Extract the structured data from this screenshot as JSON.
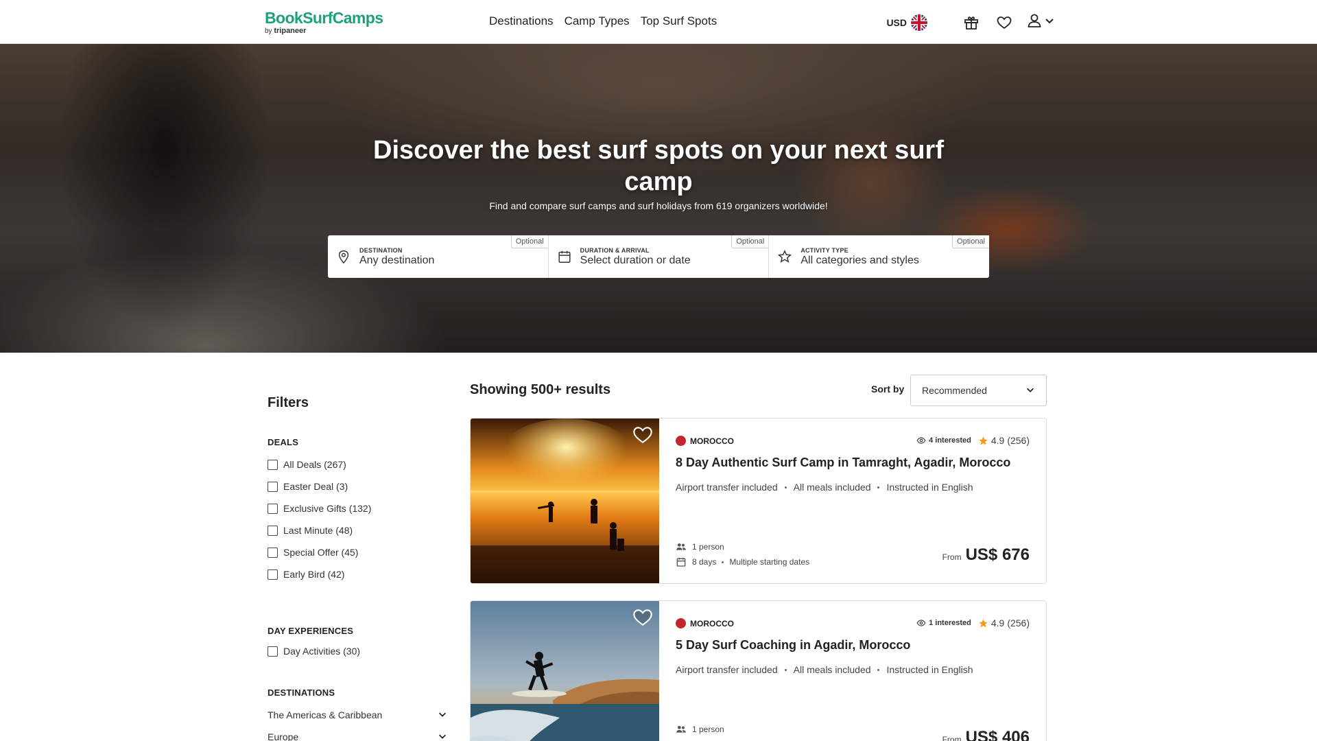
{
  "header": {
    "logo_main": "BookSurfCamps",
    "logo_by": "by",
    "logo_sub": "tripaneer",
    "nav": [
      "Destinations",
      "Camp Types",
      "Top Surf Spots"
    ],
    "currency": "USD"
  },
  "hero": {
    "title": "Discover the best surf spots on your next surf camp",
    "subtitle": "Find and compare surf camps and surf holidays from 619 organizers worldwide!",
    "search": [
      {
        "label": "DESTINATION",
        "value": "Any destination",
        "optional": "Optional"
      },
      {
        "label": "DURATION & ARRIVAL",
        "value": "Select duration or date",
        "optional": "Optional"
      },
      {
        "label": "ACTIVITY TYPE",
        "value": "All categories and styles",
        "optional": "Optional"
      }
    ]
  },
  "filters": {
    "title": "Filters",
    "deals_title": "DEALS",
    "deals": [
      "All Deals (267)",
      "Easter Deal (3)",
      "Exclusive Gifts (132)",
      "Last Minute (48)",
      "Special Offer (45)",
      "Early Bird (42)"
    ],
    "day_title": "DAY EXPERIENCES",
    "day": [
      "Day Activities (30)"
    ],
    "dest_title": "DESTINATIONS",
    "destinations": [
      "The Americas & Caribbean",
      "Europe"
    ]
  },
  "results": {
    "title": "Showing 500+ results",
    "sort_label": "Sort by",
    "sort_value": "Recommended"
  },
  "cards": [
    {
      "country": "MOROCCO",
      "interested": "4 interested",
      "rating": "4.9",
      "reviews": "(256)",
      "title": "8 Day Authentic Surf Camp in Tamraght, Agadir, Morocco",
      "features": [
        "Airport transfer included",
        "All meals included",
        "Instructed in English"
      ],
      "people": "1 person",
      "days": "8 days",
      "dates": "Multiple starting dates",
      "from": "From",
      "price": "US$ 676"
    },
    {
      "country": "MOROCCO",
      "interested": "1 interested",
      "rating": "4.9",
      "reviews": "(256)",
      "title": "5 Day Surf Coaching in Agadir, Morocco",
      "features": [
        "Airport transfer included",
        "All meals included",
        "Instructed in English"
      ],
      "people": "1 person",
      "from": "From",
      "price": "US$ 406"
    }
  ],
  "colors": {
    "brand": "#1aa37a",
    "morocco": "#c1272d",
    "star": "#f29a1f"
  }
}
